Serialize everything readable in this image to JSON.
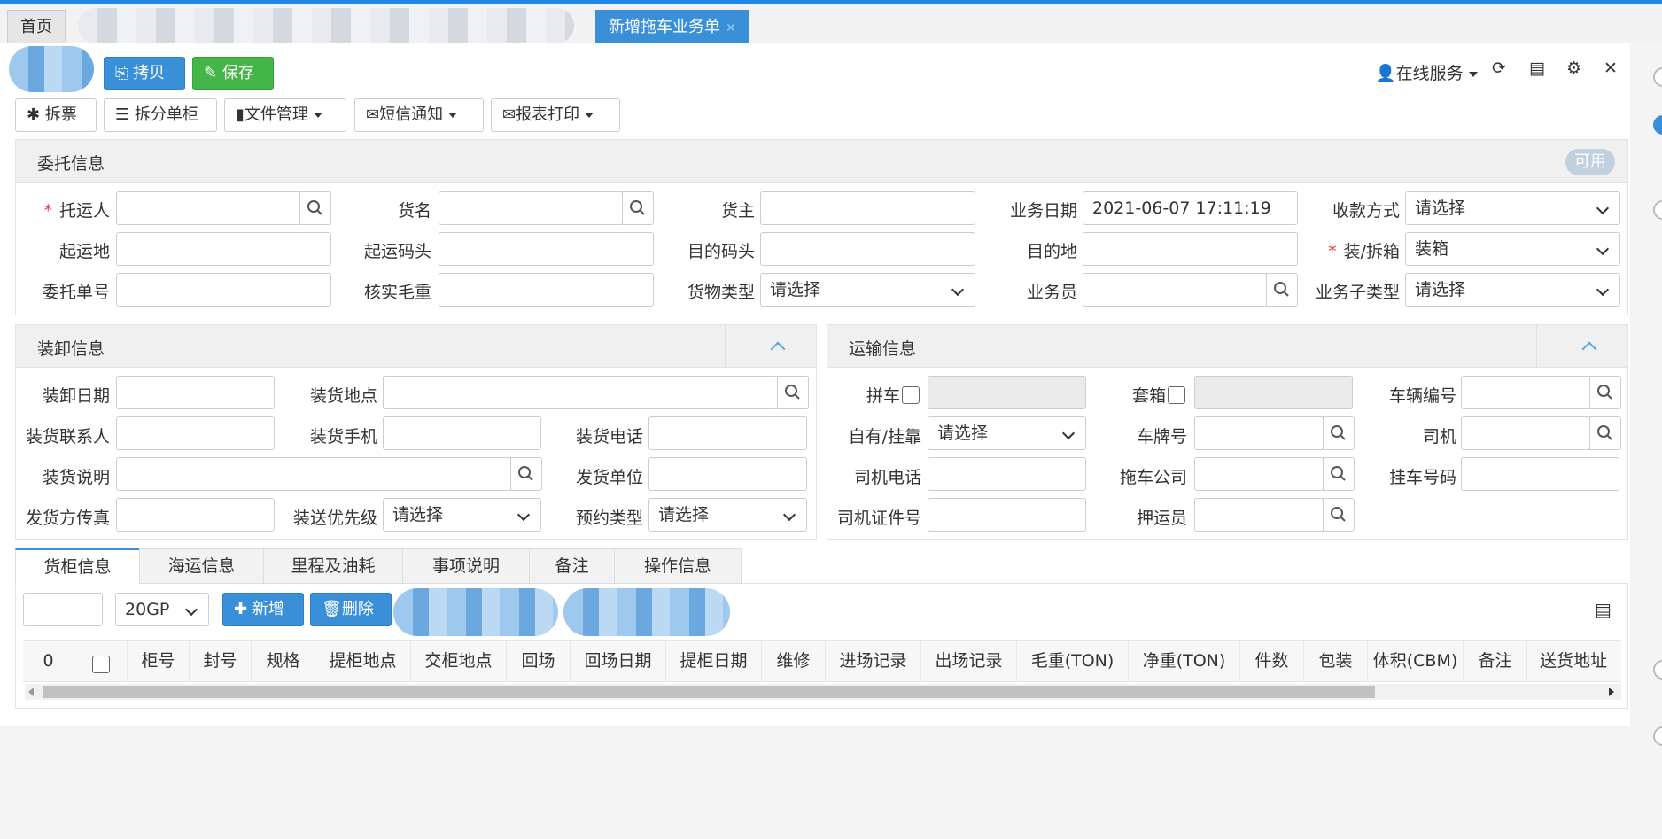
{
  "tabs": {
    "home": "首页",
    "active": "新增拖车业务单"
  },
  "toolbar": {
    "copy": "拷贝",
    "save": "保存",
    "split_ticket": "拆票",
    "split_container": "拆分单柜",
    "file_mgmt": "文件管理",
    "sms": "短信通知",
    "print": "报表打印",
    "online_service": "在线服务"
  },
  "consign": {
    "title": "委托信息",
    "status": "可用",
    "shipper": "托运人",
    "goods_name": "货名",
    "owner": "货主",
    "biz_date": "业务日期",
    "biz_date_value": "2021-06-07 17:11:19",
    "payment": "收款方式",
    "payment_value": "请选择",
    "origin": "起运地",
    "origin_port": "起运码头",
    "dest_port": "目的码头",
    "dest": "目的地",
    "load_unload": "装/拆箱",
    "load_unload_value": "装箱",
    "order_no": "委托单号",
    "gross_weight": "核实毛重",
    "cargo_type": "货物类型",
    "cargo_type_value": "请选择",
    "salesman": "业务员",
    "sub_type": "业务子类型",
    "sub_type_value": "请选择"
  },
  "loading": {
    "title": "装卸信息",
    "date": "装卸日期",
    "place": "装货地点",
    "contact": "装货联系人",
    "mobile": "装货手机",
    "phone": "装货电话",
    "note": "装货说明",
    "shipper_unit": "发货单位",
    "fax": "发货方传真",
    "priority": "装送优先级",
    "priority_value": "请选择",
    "booking": "预约类型",
    "booking_value": "请选择"
  },
  "transport": {
    "title": "运输信息",
    "carpool": "拼车",
    "set_box": "套箱",
    "vehicle_no": "车辆编号",
    "own": "自有/挂靠",
    "own_value": "请选择",
    "plate": "车牌号",
    "driver": "司机",
    "driver_phone": "司机电话",
    "company": "拖车公司",
    "trailer_no": "挂车号码",
    "driver_id": "司机证件号",
    "escort": "押运员"
  },
  "bottom_tabs": [
    "货柜信息",
    "海运信息",
    "里程及油耗",
    "事项说明",
    "备注",
    "操作信息"
  ],
  "container": {
    "size": "20GP",
    "add": "新增",
    "delete": "删除",
    "count": "0",
    "columns": [
      "柜号",
      "封号",
      "规格",
      "提柜地点",
      "交柜地点",
      "回场",
      "回场日期",
      "提柜日期",
      "维修",
      "进场记录",
      "出场记录",
      "毛重(TON)",
      "净重(TON)",
      "件数",
      "包装",
      "体积(CBM)",
      "备注",
      "送货地址"
    ]
  }
}
